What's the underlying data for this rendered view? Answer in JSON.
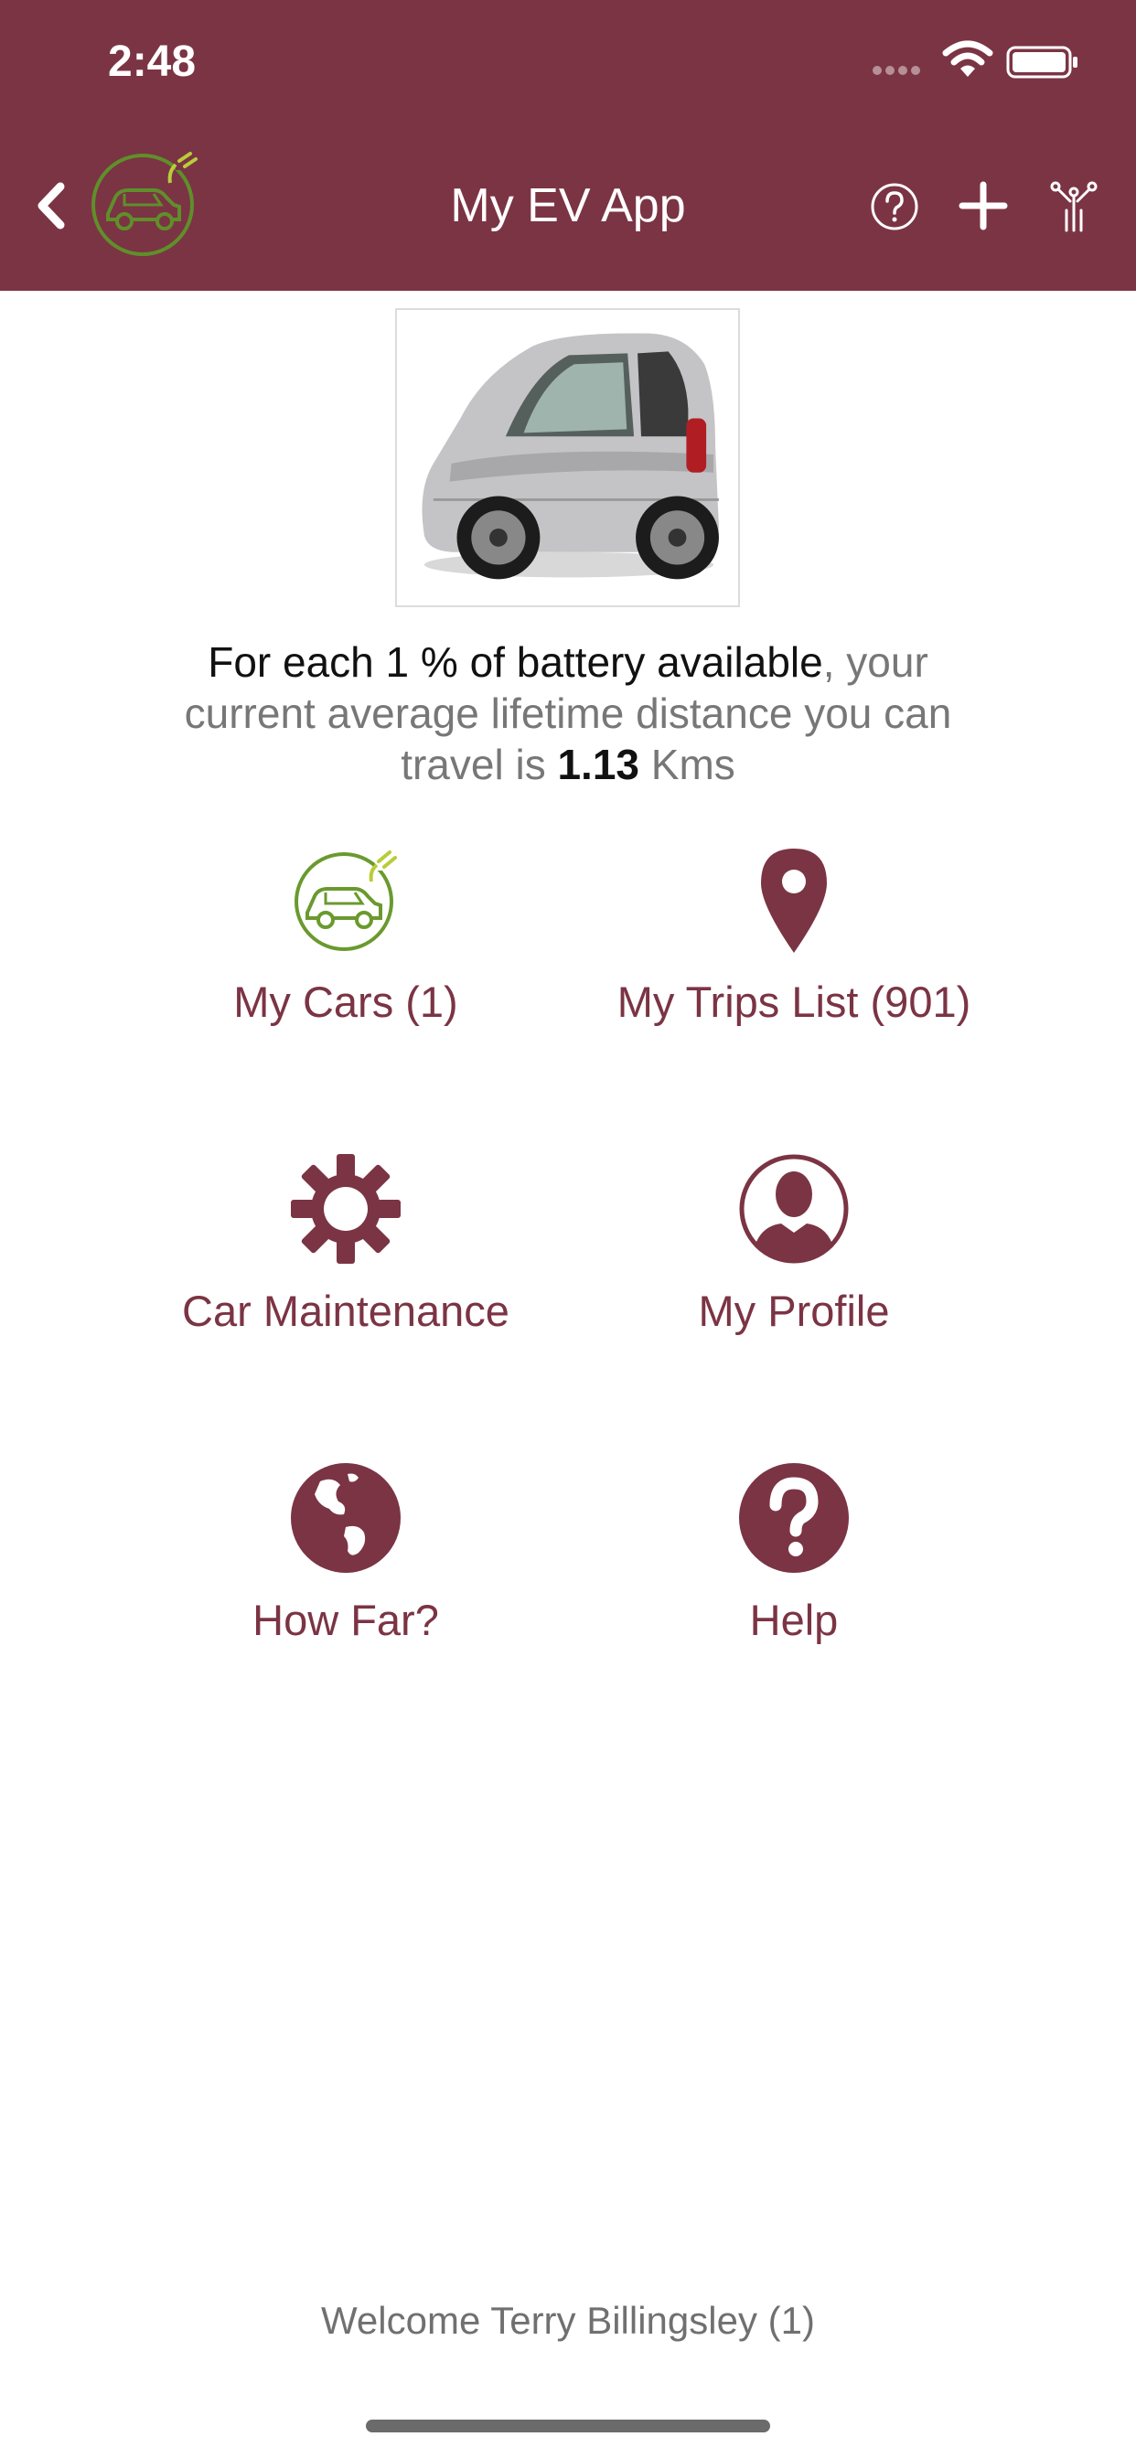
{
  "status_bar": {
    "time": "2:48"
  },
  "header": {
    "title": "My EV App"
  },
  "info": {
    "part1": "For each 1 % of battery available",
    "part2": ", your current average lifetime distance you can travel is ",
    "value": "1.13",
    "unit": " Kms"
  },
  "menu": [
    {
      "label": "My Cars (1)",
      "icon": "car-plug-icon"
    },
    {
      "label": "My Trips List (901)",
      "icon": "map-pin-icon"
    },
    {
      "label": "Car Maintenance",
      "icon": "gear-icon"
    },
    {
      "label": "My Profile",
      "icon": "profile-icon"
    },
    {
      "label": "How Far?",
      "icon": "globe-icon"
    },
    {
      "label": "Help",
      "icon": "question-icon"
    }
  ],
  "footer": {
    "welcome": "Welcome Terry Billingsley (1)"
  },
  "colors": {
    "brand": "#7b3444",
    "logo_green": "#6a9a2e"
  }
}
